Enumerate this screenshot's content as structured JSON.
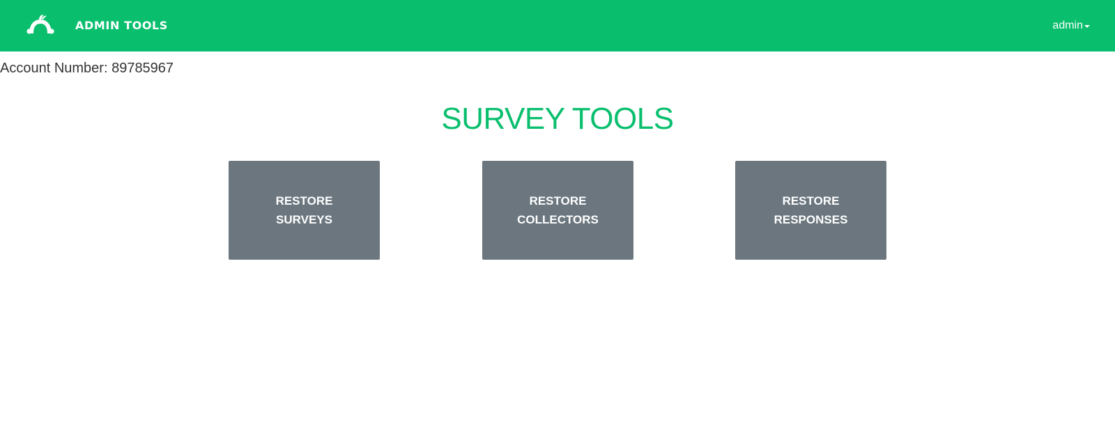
{
  "header": {
    "brand": "ADMIN TOOLS",
    "user_menu": "admin",
    "logo_icon": "monkey-logo-icon",
    "caret_icon": "caret-down-icon",
    "bg_color": "#09bf6e"
  },
  "account": {
    "text": "Account Number: 89785967"
  },
  "main": {
    "title": "SURVEY TOOLS",
    "title_color": "#09bf6e",
    "tools": [
      {
        "line1": "RESTORE",
        "line2": "SURVEYS"
      },
      {
        "line1": "RESTORE",
        "line2": "COLLECTORS"
      },
      {
        "line1": "RESTORE",
        "line2": "RESPONSES"
      }
    ],
    "tool_color": "#6b767e"
  }
}
